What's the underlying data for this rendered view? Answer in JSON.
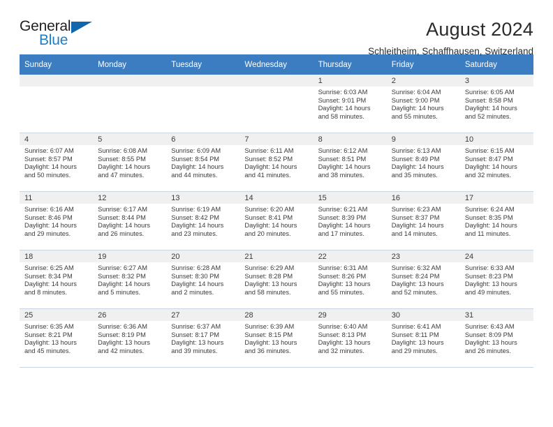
{
  "brand": {
    "name_part1": "General",
    "name_part2": "Blue",
    "accent_color": "#1f7dc4",
    "triangle_color": "#1266ab"
  },
  "header": {
    "title": "August 2024",
    "subtitle": "Schleitheim, Schaffhausen, Switzerland"
  },
  "calendar": {
    "header_bg": "#3b7dc0",
    "daynum_bg": "#f0f0f0",
    "weekday_headers": [
      "Sunday",
      "Monday",
      "Tuesday",
      "Wednesday",
      "Thursday",
      "Friday",
      "Saturday"
    ],
    "weeks": [
      [
        {
          "day": "",
          "sunrise": "",
          "sunset": "",
          "daylight_line1": "",
          "daylight_line2": "",
          "empty": true
        },
        {
          "day": "",
          "sunrise": "",
          "sunset": "",
          "daylight_line1": "",
          "daylight_line2": "",
          "empty": true
        },
        {
          "day": "",
          "sunrise": "",
          "sunset": "",
          "daylight_line1": "",
          "daylight_line2": "",
          "empty": true
        },
        {
          "day": "",
          "sunrise": "",
          "sunset": "",
          "daylight_line1": "",
          "daylight_line2": "",
          "empty": true
        },
        {
          "day": "1",
          "sunrise": "Sunrise: 6:03 AM",
          "sunset": "Sunset: 9:01 PM",
          "daylight_line1": "Daylight: 14 hours",
          "daylight_line2": "and 58 minutes."
        },
        {
          "day": "2",
          "sunrise": "Sunrise: 6:04 AM",
          "sunset": "Sunset: 9:00 PM",
          "daylight_line1": "Daylight: 14 hours",
          "daylight_line2": "and 55 minutes."
        },
        {
          "day": "3",
          "sunrise": "Sunrise: 6:05 AM",
          "sunset": "Sunset: 8:58 PM",
          "daylight_line1": "Daylight: 14 hours",
          "daylight_line2": "and 52 minutes."
        }
      ],
      [
        {
          "day": "4",
          "sunrise": "Sunrise: 6:07 AM",
          "sunset": "Sunset: 8:57 PM",
          "daylight_line1": "Daylight: 14 hours",
          "daylight_line2": "and 50 minutes."
        },
        {
          "day": "5",
          "sunrise": "Sunrise: 6:08 AM",
          "sunset": "Sunset: 8:55 PM",
          "daylight_line1": "Daylight: 14 hours",
          "daylight_line2": "and 47 minutes."
        },
        {
          "day": "6",
          "sunrise": "Sunrise: 6:09 AM",
          "sunset": "Sunset: 8:54 PM",
          "daylight_line1": "Daylight: 14 hours",
          "daylight_line2": "and 44 minutes."
        },
        {
          "day": "7",
          "sunrise": "Sunrise: 6:11 AM",
          "sunset": "Sunset: 8:52 PM",
          "daylight_line1": "Daylight: 14 hours",
          "daylight_line2": "and 41 minutes."
        },
        {
          "day": "8",
          "sunrise": "Sunrise: 6:12 AM",
          "sunset": "Sunset: 8:51 PM",
          "daylight_line1": "Daylight: 14 hours",
          "daylight_line2": "and 38 minutes."
        },
        {
          "day": "9",
          "sunrise": "Sunrise: 6:13 AM",
          "sunset": "Sunset: 8:49 PM",
          "daylight_line1": "Daylight: 14 hours",
          "daylight_line2": "and 35 minutes."
        },
        {
          "day": "10",
          "sunrise": "Sunrise: 6:15 AM",
          "sunset": "Sunset: 8:47 PM",
          "daylight_line1": "Daylight: 14 hours",
          "daylight_line2": "and 32 minutes."
        }
      ],
      [
        {
          "day": "11",
          "sunrise": "Sunrise: 6:16 AM",
          "sunset": "Sunset: 8:46 PM",
          "daylight_line1": "Daylight: 14 hours",
          "daylight_line2": "and 29 minutes."
        },
        {
          "day": "12",
          "sunrise": "Sunrise: 6:17 AM",
          "sunset": "Sunset: 8:44 PM",
          "daylight_line1": "Daylight: 14 hours",
          "daylight_line2": "and 26 minutes."
        },
        {
          "day": "13",
          "sunrise": "Sunrise: 6:19 AM",
          "sunset": "Sunset: 8:42 PM",
          "daylight_line1": "Daylight: 14 hours",
          "daylight_line2": "and 23 minutes."
        },
        {
          "day": "14",
          "sunrise": "Sunrise: 6:20 AM",
          "sunset": "Sunset: 8:41 PM",
          "daylight_line1": "Daylight: 14 hours",
          "daylight_line2": "and 20 minutes."
        },
        {
          "day": "15",
          "sunrise": "Sunrise: 6:21 AM",
          "sunset": "Sunset: 8:39 PM",
          "daylight_line1": "Daylight: 14 hours",
          "daylight_line2": "and 17 minutes."
        },
        {
          "day": "16",
          "sunrise": "Sunrise: 6:23 AM",
          "sunset": "Sunset: 8:37 PM",
          "daylight_line1": "Daylight: 14 hours",
          "daylight_line2": "and 14 minutes."
        },
        {
          "day": "17",
          "sunrise": "Sunrise: 6:24 AM",
          "sunset": "Sunset: 8:35 PM",
          "daylight_line1": "Daylight: 14 hours",
          "daylight_line2": "and 11 minutes."
        }
      ],
      [
        {
          "day": "18",
          "sunrise": "Sunrise: 6:25 AM",
          "sunset": "Sunset: 8:34 PM",
          "daylight_line1": "Daylight: 14 hours",
          "daylight_line2": "and 8 minutes."
        },
        {
          "day": "19",
          "sunrise": "Sunrise: 6:27 AM",
          "sunset": "Sunset: 8:32 PM",
          "daylight_line1": "Daylight: 14 hours",
          "daylight_line2": "and 5 minutes."
        },
        {
          "day": "20",
          "sunrise": "Sunrise: 6:28 AM",
          "sunset": "Sunset: 8:30 PM",
          "daylight_line1": "Daylight: 14 hours",
          "daylight_line2": "and 2 minutes."
        },
        {
          "day": "21",
          "sunrise": "Sunrise: 6:29 AM",
          "sunset": "Sunset: 8:28 PM",
          "daylight_line1": "Daylight: 13 hours",
          "daylight_line2": "and 58 minutes."
        },
        {
          "day": "22",
          "sunrise": "Sunrise: 6:31 AM",
          "sunset": "Sunset: 8:26 PM",
          "daylight_line1": "Daylight: 13 hours",
          "daylight_line2": "and 55 minutes."
        },
        {
          "day": "23",
          "sunrise": "Sunrise: 6:32 AM",
          "sunset": "Sunset: 8:24 PM",
          "daylight_line1": "Daylight: 13 hours",
          "daylight_line2": "and 52 minutes."
        },
        {
          "day": "24",
          "sunrise": "Sunrise: 6:33 AM",
          "sunset": "Sunset: 8:23 PM",
          "daylight_line1": "Daylight: 13 hours",
          "daylight_line2": "and 49 minutes."
        }
      ],
      [
        {
          "day": "25",
          "sunrise": "Sunrise: 6:35 AM",
          "sunset": "Sunset: 8:21 PM",
          "daylight_line1": "Daylight: 13 hours",
          "daylight_line2": "and 45 minutes."
        },
        {
          "day": "26",
          "sunrise": "Sunrise: 6:36 AM",
          "sunset": "Sunset: 8:19 PM",
          "daylight_line1": "Daylight: 13 hours",
          "daylight_line2": "and 42 minutes."
        },
        {
          "day": "27",
          "sunrise": "Sunrise: 6:37 AM",
          "sunset": "Sunset: 8:17 PM",
          "daylight_line1": "Daylight: 13 hours",
          "daylight_line2": "and 39 minutes."
        },
        {
          "day": "28",
          "sunrise": "Sunrise: 6:39 AM",
          "sunset": "Sunset: 8:15 PM",
          "daylight_line1": "Daylight: 13 hours",
          "daylight_line2": "and 36 minutes."
        },
        {
          "day": "29",
          "sunrise": "Sunrise: 6:40 AM",
          "sunset": "Sunset: 8:13 PM",
          "daylight_line1": "Daylight: 13 hours",
          "daylight_line2": "and 32 minutes."
        },
        {
          "day": "30",
          "sunrise": "Sunrise: 6:41 AM",
          "sunset": "Sunset: 8:11 PM",
          "daylight_line1": "Daylight: 13 hours",
          "daylight_line2": "and 29 minutes."
        },
        {
          "day": "31",
          "sunrise": "Sunrise: 6:43 AM",
          "sunset": "Sunset: 8:09 PM",
          "daylight_line1": "Daylight: 13 hours",
          "daylight_line2": "and 26 minutes."
        }
      ]
    ]
  }
}
